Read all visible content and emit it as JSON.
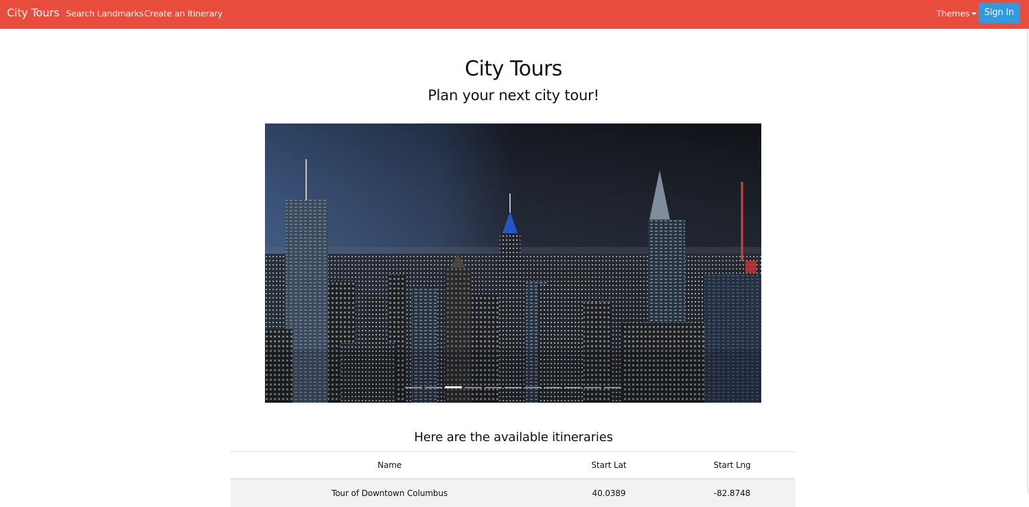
{
  "navbar": {
    "brand": "City Tours",
    "links": [
      "Search Landmarks",
      "Create an Itinerary"
    ],
    "themes_label": "Themes",
    "sign_in_label": "Sign In",
    "color": "#e74c3c",
    "button_color": "#3498db"
  },
  "hero": {
    "title": "City Tours",
    "subtitle": "Plan your next city tour!"
  },
  "carousel": {
    "slide_count": 11,
    "active_slide": 3
  },
  "itineraries": {
    "heading": "Here are the available itineraries",
    "columns": [
      "Name",
      "Start Lat",
      "Start Lng"
    ],
    "rows": [
      {
        "name": "Tour of Downtown Columbus",
        "lat": "40.0389",
        "lng": "-82.8748"
      }
    ]
  }
}
